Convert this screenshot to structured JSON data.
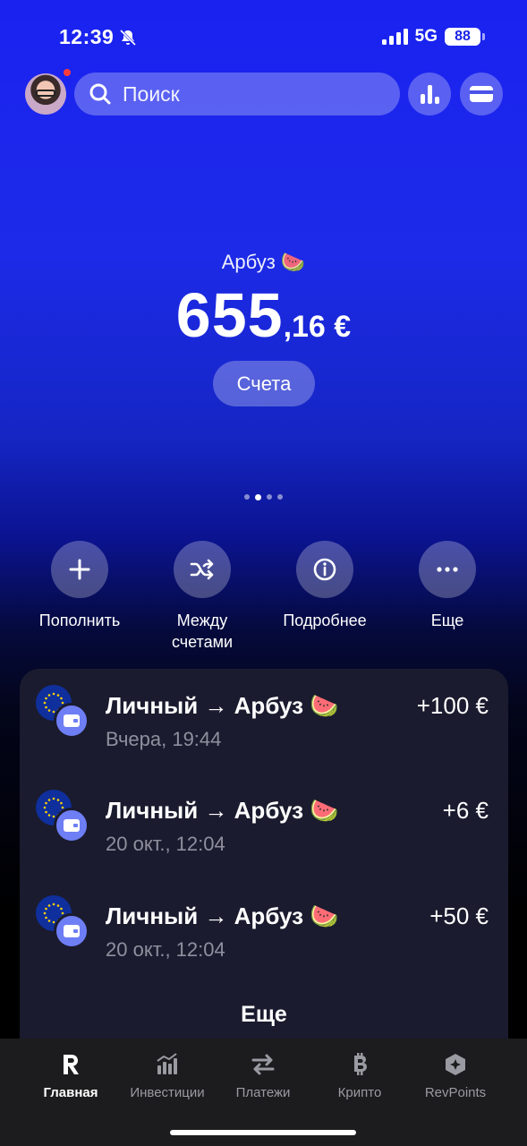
{
  "status_bar": {
    "time": "12:39",
    "network": "5G",
    "battery": "88"
  },
  "header": {
    "search_placeholder": "Поиск",
    "icons": [
      "avatar",
      "search-icon",
      "analytics-icon",
      "card-icon"
    ]
  },
  "balance": {
    "account_name": "Арбуз 🍉",
    "integer": "655",
    "fraction": ",16 €",
    "accounts_button": "Счета"
  },
  "actions": [
    {
      "label": "Пополнить",
      "icon": "plus-icon"
    },
    {
      "label": "Между счетами",
      "icon": "shuffle-icon"
    },
    {
      "label": "Подробнее",
      "icon": "info-icon"
    },
    {
      "label": "Еще",
      "icon": "more-icon"
    }
  ],
  "transactions": [
    {
      "title": "Личный → Арбуз 🍉",
      "date": "Вчера, 19:44",
      "amount": "+100 €"
    },
    {
      "title": "Личный → Арбуз 🍉",
      "date": "20 окт., 12:04",
      "amount": "+6 €"
    },
    {
      "title": "Личный → Арбуз 🍉",
      "date": "20 окт., 12:04",
      "amount": "+50 €"
    }
  ],
  "transactions_more": "Еще",
  "tabs": [
    {
      "label": "Главная",
      "icon": "revolut-icon",
      "active": true
    },
    {
      "label": "Инвестиции",
      "icon": "invest-icon",
      "active": false
    },
    {
      "label": "Платежи",
      "icon": "transfer-icon",
      "active": false
    },
    {
      "label": "Крипто",
      "icon": "bitcoin-icon",
      "active": false
    },
    {
      "label": "RevPoints",
      "icon": "revpoints-icon",
      "active": false
    }
  ],
  "colors": {
    "accent": "#1a22f0",
    "card_bg": "#1a1b2e",
    "wallet_badge": "#6e7ef5",
    "tabbar": "#1c1c1e"
  }
}
